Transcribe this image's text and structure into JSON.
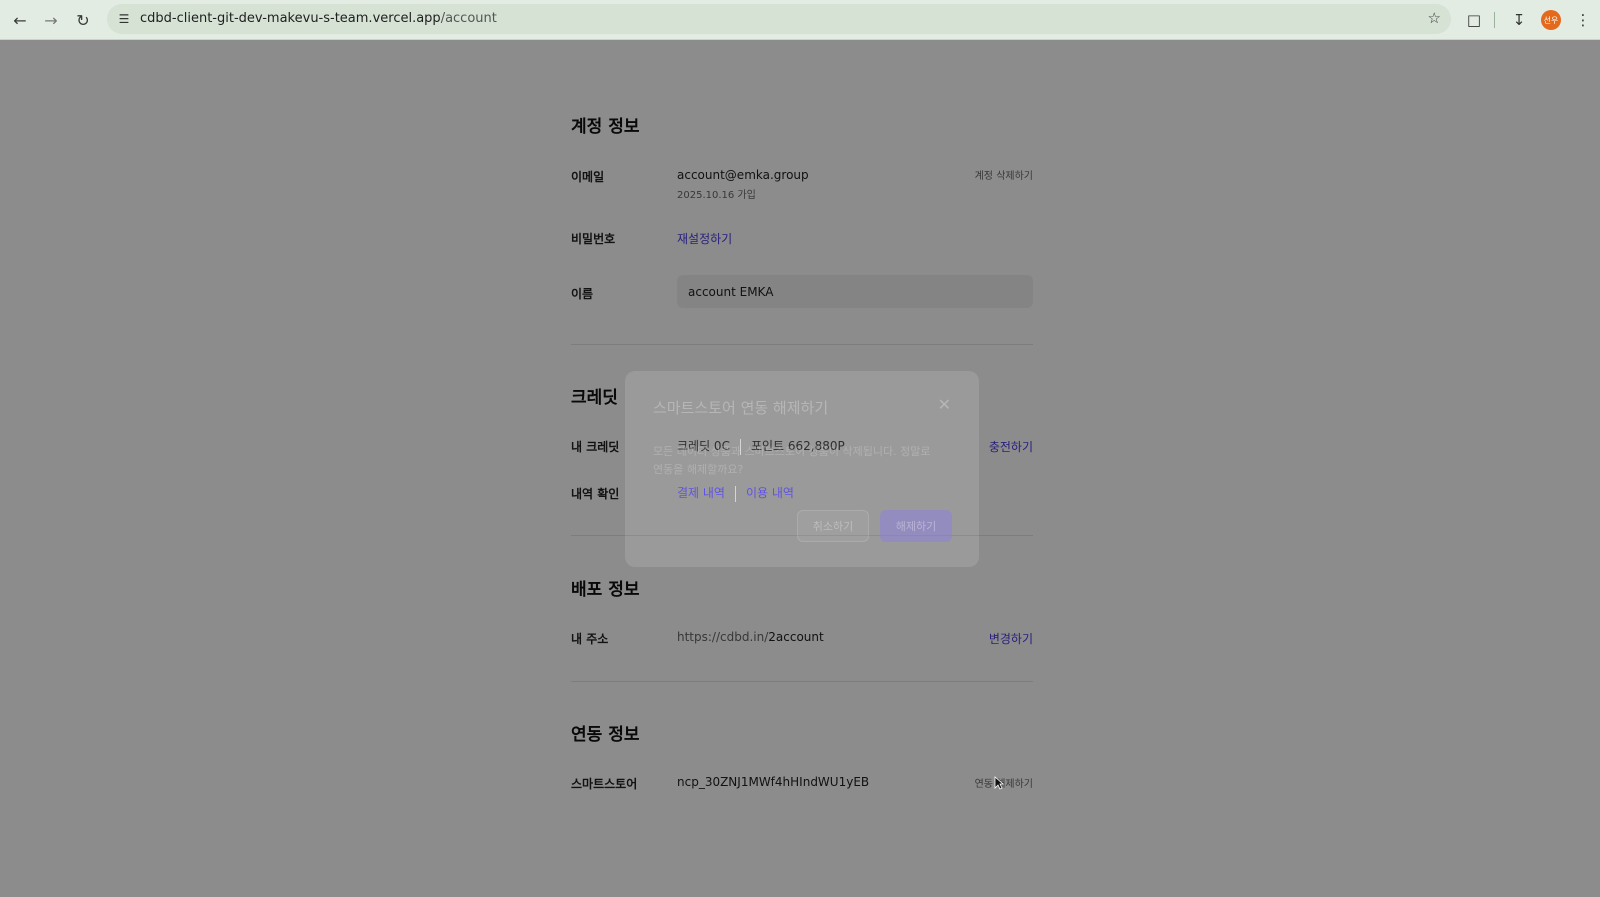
{
  "browser": {
    "url_host": "cdbd-client-git-dev-makevu-s-team.vercel.app",
    "url_path": "/account",
    "profile_initials": "선우"
  },
  "account": {
    "title": "계정 정보",
    "email_label": "이메일",
    "email_value": "account@emka.group",
    "joined": "2025.10.16 가입",
    "delete_account": "계정 삭제하기",
    "password_label": "비밀번호",
    "password_reset": "재설정하기",
    "name_label": "이름",
    "name_value": "account EMKA"
  },
  "credit": {
    "title": "크레딧",
    "my_credit_label": "내 크레딧",
    "credit_value": "크레딧 0C",
    "points_value": "포인트 662,880P",
    "charge": "충전하기",
    "history_label": "내역 확인",
    "payment_history": "결제 내역",
    "usage_history": "이용 내역"
  },
  "deploy": {
    "title": "배포 정보",
    "address_label": "내 주소",
    "address_prefix": "https://cdbd.in/",
    "address_slug": "2account",
    "change": "변경하기"
  },
  "integration": {
    "title": "연동 정보",
    "smartstore_label": "스마트스토어",
    "smartstore_value": "ncp_30ZNJ1MWf4hHIndWU1yEB",
    "disconnect": "연동 해제하기"
  },
  "modal": {
    "title": "스마트스토어 연동 해제하기",
    "body": "모든 데이터 상품과 스마트스토어 상품이 삭제됩니다. 정말로 연동을 해제할까요?",
    "cancel": "취소하기",
    "confirm": "해제하기"
  }
}
